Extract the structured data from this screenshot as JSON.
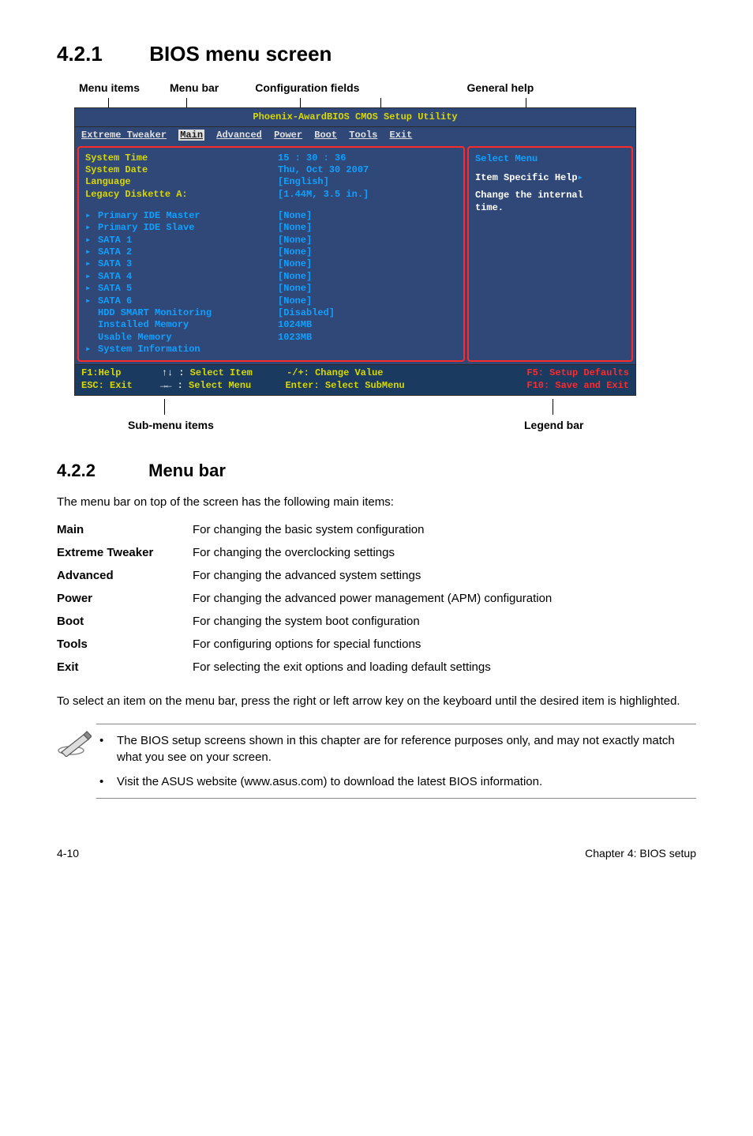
{
  "section_421": {
    "num": "4.2.1",
    "title": "BIOS menu screen"
  },
  "top_labels": {
    "l1": "Menu items",
    "l2": "Menu bar",
    "l3": "Configuration fields",
    "l4": "General help"
  },
  "bios": {
    "heading": "Phoenix-AwardBIOS CMOS Setup Utility",
    "menubar": [
      "Extreme Tweaker",
      "Main",
      "Advanced",
      "Power",
      "Boot",
      "Tools",
      "Exit"
    ],
    "left_labels": {
      "system_time": "System Time",
      "system_date": "System Date",
      "language": "Language",
      "legacy": "Legacy Diskette A:",
      "pri_master": "Primary IDE Master",
      "pri_slave": "Primary IDE Slave",
      "sata1": "SATA 1",
      "sata2": "SATA 2",
      "sata3": "SATA 3",
      "sata4": "SATA 4",
      "sata5": "SATA 5",
      "sata6": "SATA 6",
      "hdd_smart": "HDD SMART Monitoring",
      "installed_mem": "Installed Memory",
      "usable_mem": "Usable Memory",
      "sys_info": "System Information"
    },
    "left_values": {
      "system_time": "15 : 30 : 36",
      "system_date": "Thu, Oct 30 2007",
      "language": "[English]",
      "legacy": "[1.44M, 3.5 in.]",
      "pri_master": "[None]",
      "pri_slave": "[None]",
      "sata1": "[None]",
      "sata2": "[None]",
      "sata3": "[None]",
      "sata4": "[None]",
      "sata5": "[None]",
      "sata6": "[None]",
      "hdd_smart": "[Disabled]",
      "installed_mem": "1024MB",
      "usable_mem": "1023MB"
    },
    "right": {
      "select_menu": "Select Menu",
      "item_help": "Item Specific Help",
      "change_internal": "Change the internal",
      "time": "time."
    },
    "foot": {
      "f1": "F1:Help",
      "sel_item": "Select Item",
      "change_val": "-/+: Change Value",
      "f5": "F5: Setup Defaults",
      "esc": "ESC: Exit",
      "sel_menu": "Select Menu",
      "enter": "Enter: Select SubMenu",
      "f10": "F10: Save and Exit",
      "arrows_ud": "↑↓ :",
      "arrows_lr": "→← :"
    }
  },
  "bottom_labels": {
    "sub": "Sub-menu items",
    "legend": "Legend bar"
  },
  "section_422": {
    "num": "4.2.2",
    "title": "Menu bar"
  },
  "menubar_intro": "The menu bar on top of the screen has the following main items:",
  "defs": {
    "main_k": "Main",
    "main_v": "For changing the basic system configuration",
    "et_k": "Extreme Tweaker",
    "et_v": "For changing the overclocking settings",
    "adv_k": "Advanced",
    "adv_v": "For changing the advanced system settings",
    "pow_k": "Power",
    "pow_v": "For changing the advanced power management (APM) configuration",
    "boot_k": "Boot",
    "boot_v": "For changing the system boot configuration",
    "tools_k": "Tools",
    "tools_v": "For configuring options for special functions",
    "exit_k": "Exit",
    "exit_v": "For selecting the exit options and loading default settings"
  },
  "select_para": "To select an item on the menu bar, press the right or left arrow key on the keyboard until the desired item is highlighted.",
  "notes": {
    "n1": "The BIOS setup screens shown in this chapter are for reference purposes only, and may not exactly match what you see on your screen.",
    "n2": "Visit the ASUS website (www.asus.com) to download the latest BIOS information."
  },
  "footer": {
    "left": "4-10",
    "right": "Chapter 4: BIOS setup"
  }
}
